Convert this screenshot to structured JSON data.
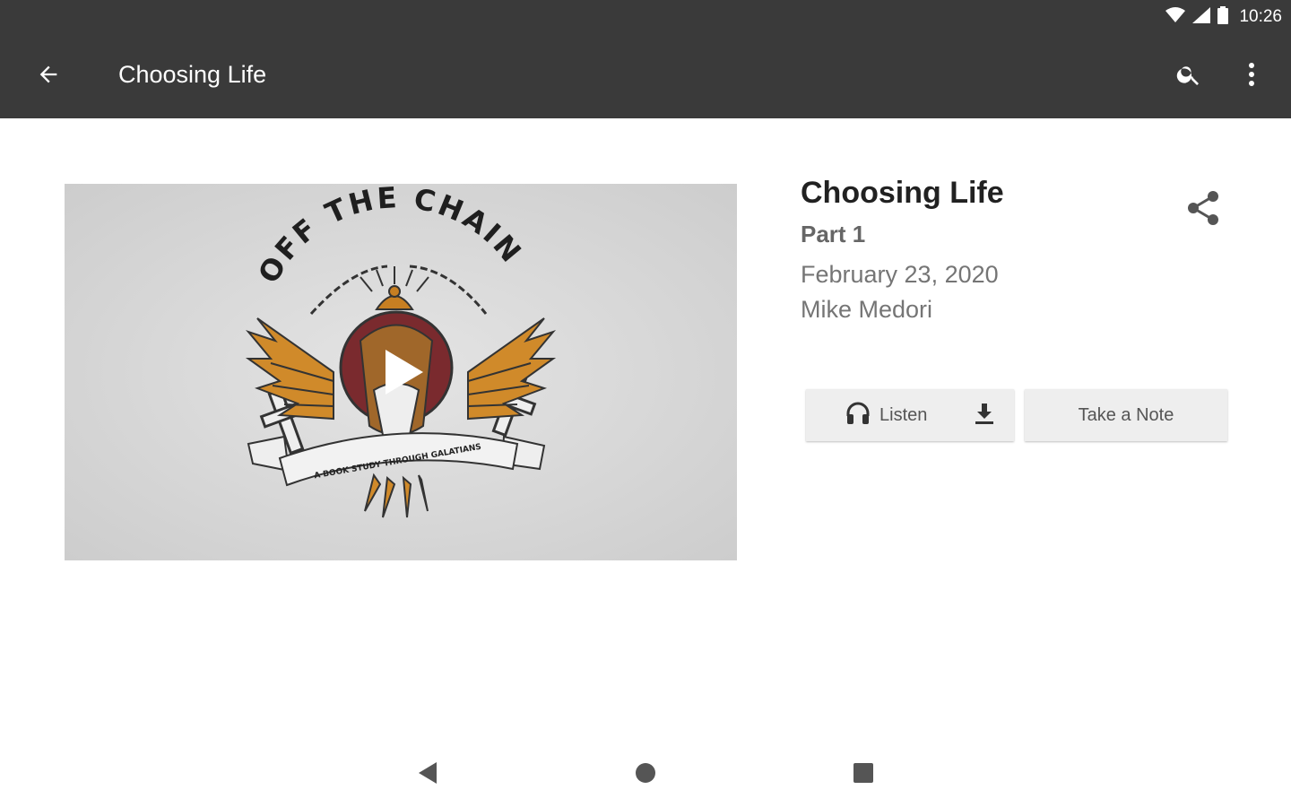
{
  "status_bar": {
    "time": "10:26",
    "icons": [
      "wifi-icon",
      "signal-icon",
      "battery-icon"
    ]
  },
  "app_bar": {
    "title": "Choosing Life",
    "icons": [
      "back-arrow-icon",
      "search-icon",
      "more-vert-icon"
    ]
  },
  "media": {
    "artwork_lettering": [
      "OFF THE CHAIN",
      "A BOOK STUDY THROUGH GALATIANS"
    ],
    "play_icon": "play-icon"
  },
  "sermon": {
    "title": "Choosing Life",
    "part": "Part 1",
    "date": "February 23, 2020",
    "speaker": "Mike Medori"
  },
  "actions": {
    "listen_label": "Listen",
    "take_note_label": "Take a Note",
    "icons": [
      "headphones-icon",
      "download-icon",
      "share-icon"
    ]
  },
  "nav_bar": {
    "icons": [
      "nav-back-icon",
      "nav-home-icon",
      "nav-recents-icon"
    ]
  },
  "colors": {
    "bar": "#3a3a3a",
    "button_bg": "#eeeeee",
    "artwork_accent": "#d08a2a",
    "artwork_red": "#7a2a2e"
  }
}
